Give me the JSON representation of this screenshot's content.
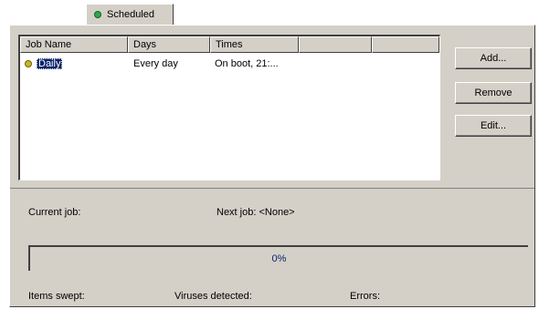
{
  "tab": {
    "label": "Scheduled"
  },
  "list": {
    "columns": [
      "Job Name",
      "Days",
      "Times"
    ],
    "rows": [
      {
        "name": "Daily",
        "days": "Every day",
        "times": "On boot, 21:..."
      }
    ]
  },
  "buttons": {
    "add": "Add...",
    "remove": "Remove",
    "edit": "Edit..."
  },
  "status": {
    "current_job": "Current job:",
    "next_job": "Next job: <None>",
    "progress": "0%",
    "items_swept": "Items swept:",
    "viruses_detected": "Viruses detected:",
    "errors": "Errors:"
  },
  "colors": {
    "status_dot": "#2fa84a",
    "job_dot": "#c8b820",
    "selection": "#0a246a"
  }
}
